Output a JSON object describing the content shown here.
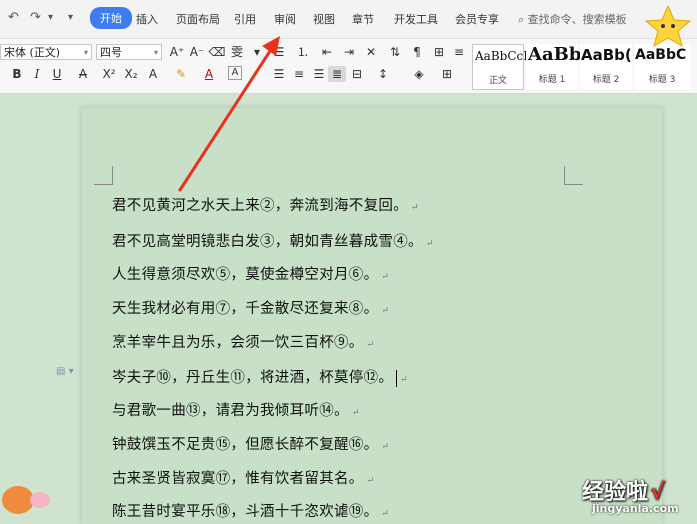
{
  "menubar": {
    "quick_undo": "↶",
    "quick_redo": "↷",
    "quick_more": "▾",
    "tabs": [
      "开始",
      "插入",
      "页面布局",
      "引用",
      "审阅",
      "视图",
      "章节",
      "开发工具",
      "会员专享"
    ],
    "active_tab": "开始",
    "search_placeholder": "查找命令、搜索模板"
  },
  "toolbar": {
    "font_name": "宋体 (正文)",
    "font_size": "四号",
    "styles": [
      {
        "sample": "AaBbCcI",
        "name": "正文"
      },
      {
        "sample": "AaBb",
        "name": "标题 1"
      },
      {
        "sample": "AaBb(",
        "name": "标题 2"
      },
      {
        "sample": "AaBbC",
        "name": "标题 3"
      }
    ]
  },
  "document": {
    "lines": [
      "君不见黄河之水天上来②，奔流到海不复回。",
      "君不见高堂明镜悲白发③，朝如青丝暮成雪④。",
      "人生得意须尽欢⑤，莫使金樽空对月⑥。",
      "天生我材必有用⑦，千金散尽还复来⑧。",
      "烹羊宰牛且为乐，会须一饮三百杯⑨。",
      "岑夫子⑩，丹丘生⑪，将进酒，杯莫停⑫。",
      "与君歌一曲⑬，请君为我倾耳听⑭。",
      "钟鼓馔玉不足贵⑮，但愿长醉不复醒⑯。",
      "古来圣贤皆寂寞⑰，惟有饮者留其名。",
      "陈王昔时宴平乐⑱，斗酒十千恣欢谑⑲。"
    ],
    "paragraph_mark": "↵"
  },
  "watermark": {
    "text": "经验啦",
    "check": "√",
    "url": "jingyanla.com"
  },
  "colors": {
    "accent": "#3f7cf0",
    "page_background": "#c7e0c7",
    "annotation_arrow": "#e8321e"
  }
}
